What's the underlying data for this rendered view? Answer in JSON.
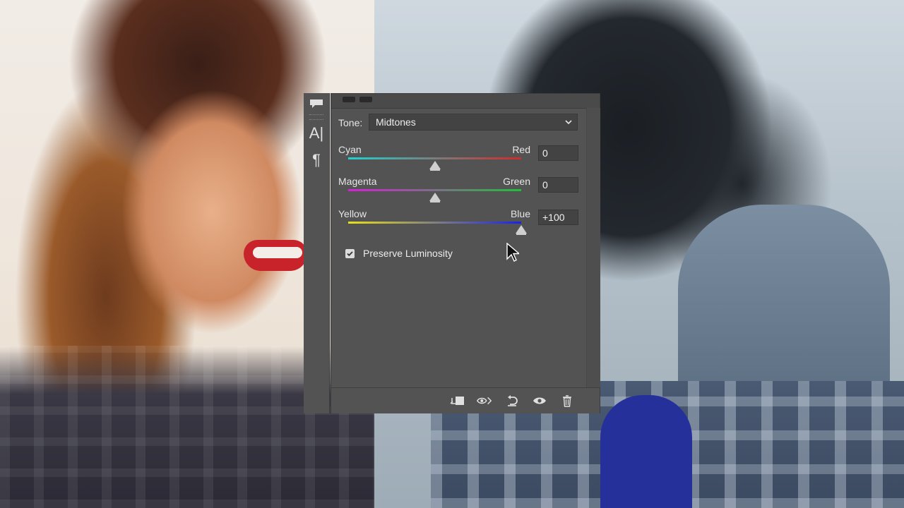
{
  "properties": {
    "tone_label": "Tone:",
    "tone_value": "Midtones",
    "sliders": [
      {
        "left": "Cyan",
        "right": "Red",
        "value": "0",
        "position": 0.5,
        "colors": [
          "#20d2d2",
          "#d22a2a"
        ]
      },
      {
        "left": "Magenta",
        "right": "Green",
        "value": "0",
        "position": 0.5,
        "colors": [
          "#d81ed8",
          "#20c03a"
        ]
      },
      {
        "left": "Yellow",
        "right": "Blue",
        "value": "+100",
        "position": 1.0,
        "colors": [
          "#e8e01a",
          "#1a22e8"
        ]
      }
    ],
    "preserve_luminosity_label": "Preserve Luminosity",
    "preserve_luminosity_checked": true
  },
  "toolbar": {
    "text_tool_glyph": "A|",
    "paragraph_tool_glyph": "¶"
  },
  "footer_icons": [
    "clip-to-layer-icon",
    "view-previous-state-icon",
    "reset-icon",
    "visibility-icon",
    "trash-icon"
  ]
}
